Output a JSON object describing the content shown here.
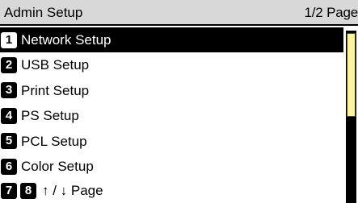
{
  "header": {
    "title": "Admin Setup",
    "page": "1/2 Page"
  },
  "menu": {
    "items": [
      {
        "num": "1",
        "label": "Network Setup",
        "selected": true
      },
      {
        "num": "2",
        "label": "USB Setup"
      },
      {
        "num": "3",
        "label": "Print Setup"
      },
      {
        "num": "4",
        "label": "PS Setup"
      },
      {
        "num": "5",
        "label": "PCL Setup"
      },
      {
        "num": "6",
        "label": "Color Setup"
      }
    ]
  },
  "nav": {
    "num_up": "7",
    "num_down": "8",
    "label": "↑ / ↓ Page"
  },
  "scrollbar": {
    "position_fraction": 0.0,
    "visible_fraction": 0.5
  },
  "colors": {
    "header_bg": "#d8d8d8",
    "selected_bg": "#000000",
    "thumb": "#fff2a0"
  }
}
